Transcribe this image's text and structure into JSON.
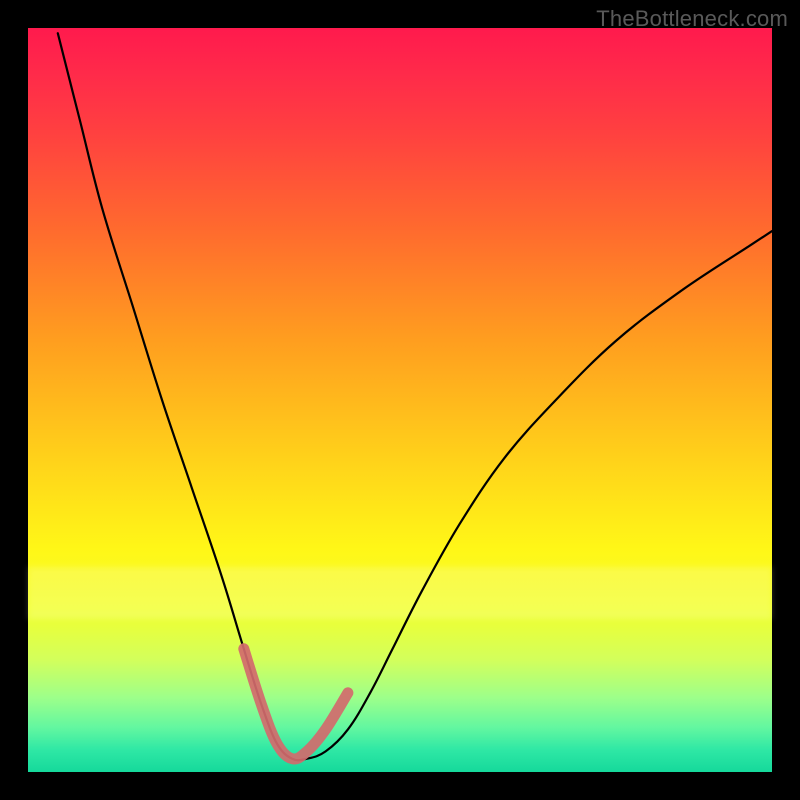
{
  "watermark": "TheBottleneck.com",
  "colors": {
    "background": "#000000",
    "curve": "#000000",
    "highlight": "#d26a6d",
    "gradient_stops": [
      "#ff1a4d",
      "#ff4040",
      "#ff9e1f",
      "#ffd21a",
      "#fff717",
      "#9dff8a",
      "#15d99b"
    ]
  },
  "chart_data": {
    "type": "line",
    "title": "",
    "xlabel": "",
    "ylabel": "",
    "x_range_visible": [
      0.04,
      1.0
    ],
    "y_range": [
      0,
      1
    ],
    "note": "No axis ticks or numeric labels are rendered in the image; x and y are normalized 0–1. y represents a bottleneck/mismatch metric that drops to ~0 in a valley and rises on either side.",
    "series": [
      {
        "name": "bottleneck-curve",
        "x": [
          0.04,
          0.07,
          0.1,
          0.14,
          0.18,
          0.22,
          0.26,
          0.29,
          0.315,
          0.335,
          0.355,
          0.375,
          0.4,
          0.43,
          0.46,
          0.49,
          0.53,
          0.58,
          0.64,
          0.71,
          0.79,
          0.88,
          0.97,
          1.0
        ],
        "y": [
          1.0,
          0.88,
          0.76,
          0.63,
          0.5,
          0.38,
          0.26,
          0.16,
          0.08,
          0.03,
          0.01,
          0.01,
          0.02,
          0.05,
          0.1,
          0.16,
          0.24,
          0.33,
          0.42,
          0.5,
          0.58,
          0.65,
          0.71,
          0.73
        ]
      }
    ],
    "highlight_segment": {
      "name": "valley-highlight",
      "x": [
        0.29,
        0.315,
        0.335,
        0.355,
        0.375,
        0.4,
        0.43
      ],
      "y": [
        0.16,
        0.08,
        0.03,
        0.01,
        0.02,
        0.05,
        0.1
      ]
    }
  }
}
